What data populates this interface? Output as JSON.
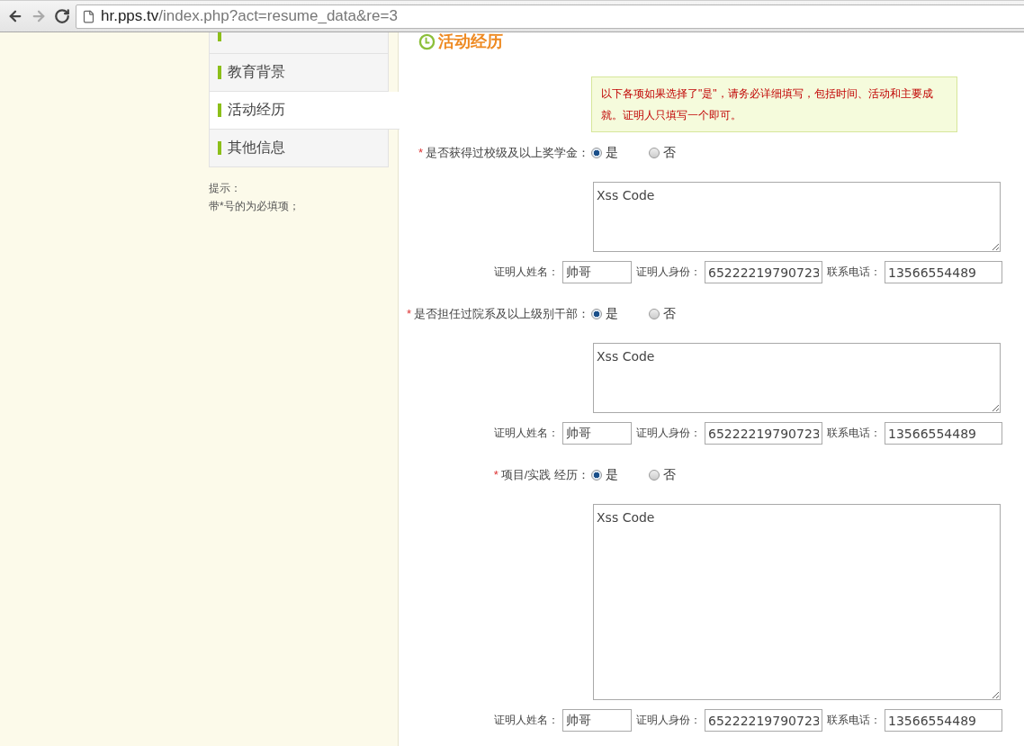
{
  "browser": {
    "url_host": "hr.pps.tv",
    "url_path": "/index.php?act=resume_data&re=3"
  },
  "sidebar": {
    "items": [
      {
        "selected": false
      },
      {
        "label": "教育背景",
        "selected": false
      },
      {
        "label": "活动经历",
        "selected": true
      },
      {
        "label": "其他信息",
        "selected": false
      }
    ],
    "hint_title": "提示：",
    "hint_text": "带*号的为必填项；"
  },
  "section": {
    "title": "活动经历",
    "note": "以下各项如果选择了\"是\"，请务必详细填写，包括时间、活动和主要成就。证明人只填写一个即可。"
  },
  "questions": [
    {
      "marker": "*",
      "label": "是否获得过校级及以上奖学金：",
      "options": [
        {
          "label": "是",
          "selected": true
        },
        {
          "label": "否",
          "selected": false
        }
      ],
      "answer": "Xss Code",
      "kind": "short",
      "witness": [
        {
          "label": "证明人姓名：",
          "value": "帅哥"
        },
        {
          "label": "证明人身份：",
          "value": "65222219790723"
        },
        {
          "label": "联系电话：",
          "value": "13566554489"
        }
      ]
    },
    {
      "marker": "*",
      "label": "是否担任过院系及以上级别干部：",
      "options": [
        {
          "label": "是",
          "selected": true
        },
        {
          "label": "否",
          "selected": false
        }
      ],
      "answer": "Xss Code",
      "kind": "short",
      "witness": [
        {
          "label": "证明人姓名：",
          "value": "帅哥"
        },
        {
          "label": "证明人身份：",
          "value": "65222219790723"
        },
        {
          "label": "联系电话：",
          "value": "13566554489"
        }
      ]
    },
    {
      "marker": "*",
      "label": "项目/实践 经历：",
      "options": [
        {
          "label": "是",
          "selected": true
        },
        {
          "label": "否",
          "selected": false
        }
      ],
      "answer": "Xss Code",
      "kind": "tall",
      "witness": [
        {
          "label": "证明人姓名：",
          "value": "帅哥"
        },
        {
          "label": "证明人身份：",
          "value": "65222219790723"
        },
        {
          "label": "联系电话：",
          "value": "13566554489"
        }
      ]
    }
  ]
}
